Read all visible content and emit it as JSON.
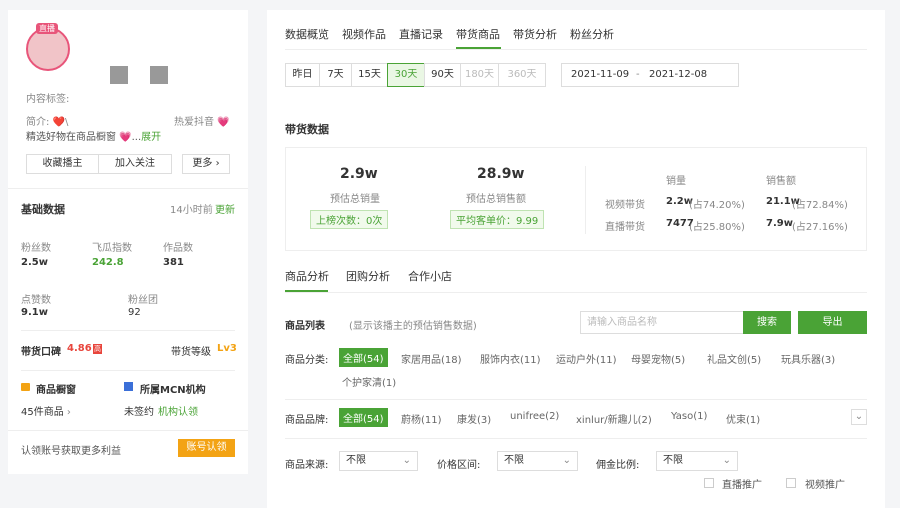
{
  "profile": {
    "avatar_badge": "直播",
    "content_tags_label": "内容标签:",
    "intro_label": "简介: ❤️\\",
    "intro_text": "精选好物在商品橱窗 💗...",
    "expand": "展开",
    "popular_tag": "热爱抖音 💗",
    "collect_button": "收藏播主",
    "follow_button": "加入关注",
    "more_button": "更多"
  },
  "basic": {
    "title": "基础数据",
    "updated": "14小时前",
    "update_link": "更新",
    "stats": [
      {
        "label": "粉丝数",
        "value": "2.5w"
      },
      {
        "label": "飞瓜指数",
        "value": "242.8"
      },
      {
        "label": "作品数",
        "value": "381"
      },
      {
        "label": "点赞数",
        "value": "9.1w"
      },
      {
        "label": "粉丝团",
        "value": "92"
      }
    ],
    "reputation_label": "带货口碑",
    "reputation_value": "4.86",
    "reputation_badge": "高",
    "level_label": "带货等级",
    "level_value": "Lv3",
    "shop_title": "商品橱窗",
    "shop_count": "45件商品",
    "mcn_title": "所属MCN机构",
    "mcn_status": "未签约",
    "mcn_link": "机构认领",
    "claim_text": "认领账号获取更多利益",
    "claim_button": "账号认领"
  },
  "tabs": [
    "数据概览",
    "视频作品",
    "直播记录",
    "带货商品",
    "带货分析",
    "粉丝分析"
  ],
  "active_tab_index": 3,
  "ranges": [
    "昨日",
    "7天",
    "15天",
    "30天",
    "90天",
    "180天",
    "360天"
  ],
  "active_range_index": 3,
  "date_start": "2021-11-09",
  "date_sep": "-",
  "date_end": "2021-12-08",
  "sales": {
    "title": "带货数据",
    "est_sales_value": "2.9w",
    "est_sales_label": "预估总销量",
    "rank_count": "上榜次数：0次",
    "est_revenue_value": "28.9w",
    "est_revenue_label": "预估总销售额",
    "avg_price": "平均客单价：9.99",
    "col_sales": "销量",
    "col_revenue": "销售额",
    "rows": [
      {
        "label": "视频带货",
        "sales": "2.2w",
        "sales_pct": "(占74.20%)",
        "revenue": "21.1w",
        "revenue_pct": "(占72.84%)"
      },
      {
        "label": "直播带货",
        "sales": "7477",
        "sales_pct": "(占25.80%)",
        "revenue": "7.9w",
        "revenue_pct": "(占27.16%)"
      }
    ]
  },
  "subtabs": [
    "商品分析",
    "团购分析",
    "合作小店"
  ],
  "active_subtab_index": 0,
  "products": {
    "title": "商品列表",
    "subtitle": "(显示该播主的预估销售数据)",
    "search_placeholder": "请输入商品名称",
    "search_button": "搜索",
    "export_button": "导出",
    "category_label": "商品分类:",
    "categories": [
      "全部(54)",
      "家居用品(18)",
      "服饰内衣(11)",
      "运动户外(11)",
      "母婴宠物(5)",
      "礼品文创(5)",
      "玩具乐器(3)",
      "个护家清(1)"
    ],
    "brand_label": "商品品牌:",
    "brands": [
      "全部(54)",
      "蔚杨(11)",
      "康发(3)",
      "unifree(2)",
      "xinlur/新趣儿(2)",
      "Yaso(1)",
      "优束(1)"
    ],
    "source_label": "商品来源:",
    "source_value": "不限",
    "price_label": "价格区间:",
    "price_value": "不限",
    "commission_label": "佣金比例:",
    "commission_value": "不限",
    "live_promo": "直播推广",
    "video_promo": "视频推广"
  }
}
